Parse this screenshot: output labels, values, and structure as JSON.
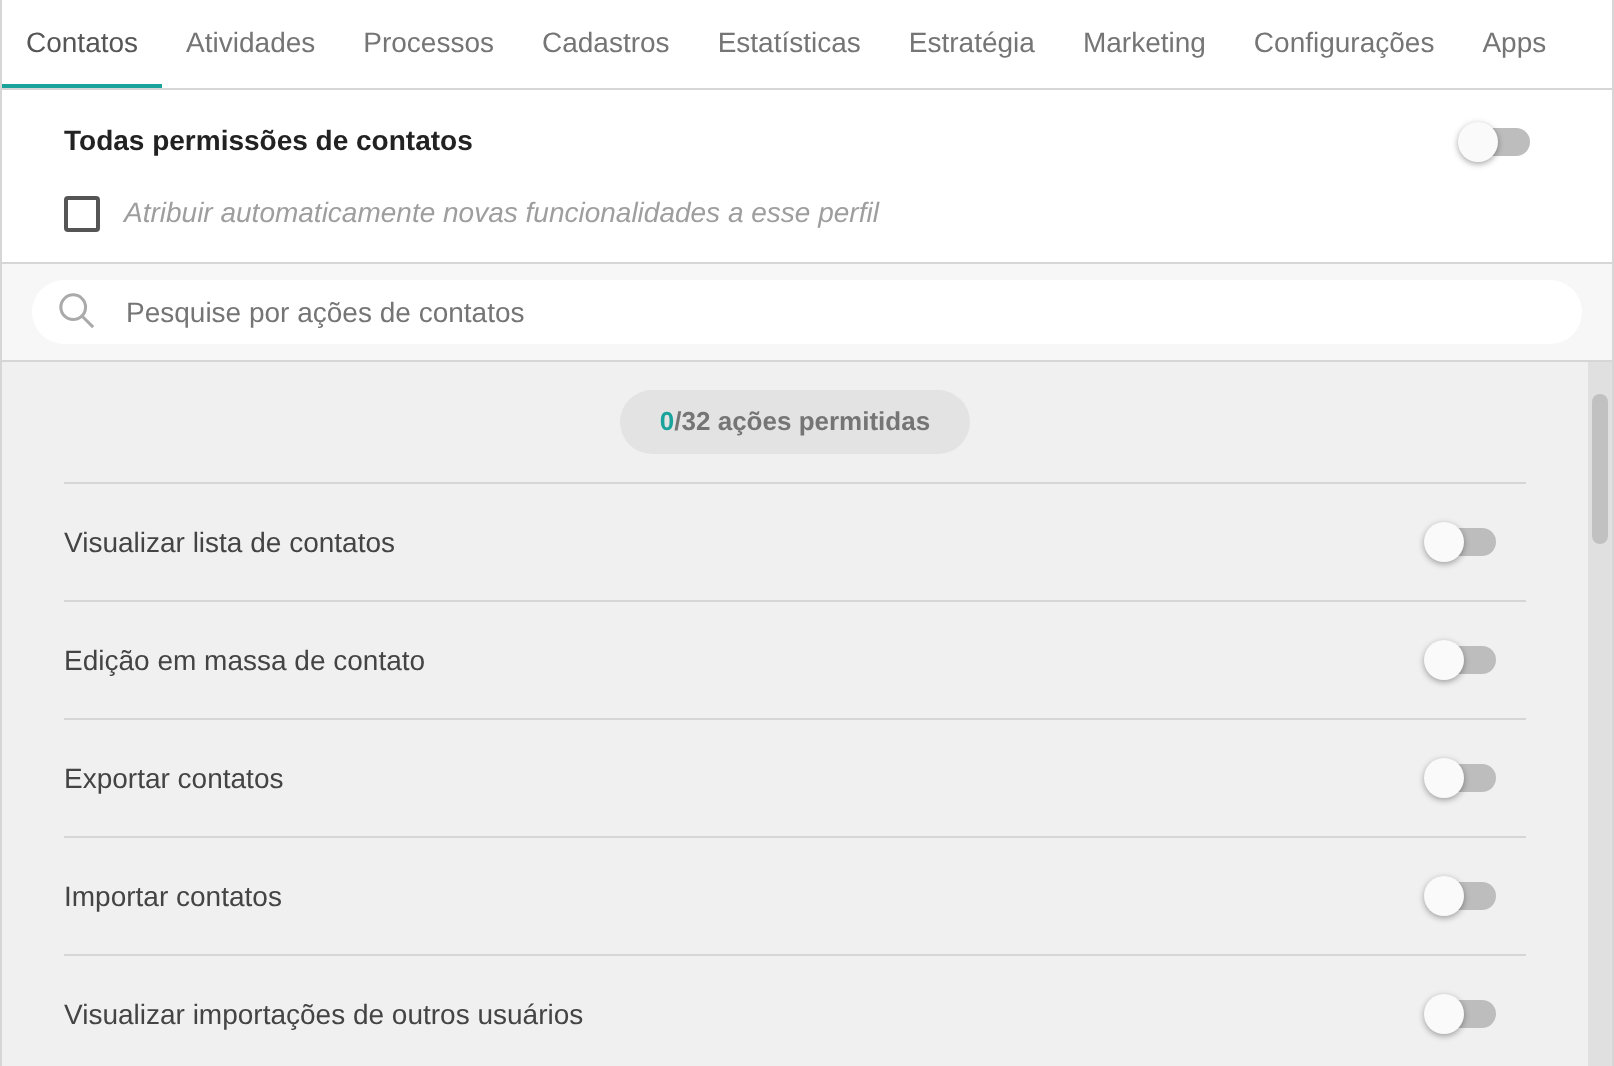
{
  "tabs": [
    {
      "label": "Contatos",
      "selected": true
    },
    {
      "label": "Atividades",
      "selected": false
    },
    {
      "label": "Processos",
      "selected": false
    },
    {
      "label": "Cadastros",
      "selected": false
    },
    {
      "label": "Estatísticas",
      "selected": false
    },
    {
      "label": "Estratégia",
      "selected": false
    },
    {
      "label": "Marketing",
      "selected": false
    },
    {
      "label": "Configurações",
      "selected": false
    },
    {
      "label": "Apps",
      "selected": false
    }
  ],
  "all_permissions": {
    "label": "Todas permissões de contatos",
    "on": false
  },
  "auto_assign": {
    "label": "Atribuir automaticamente novas funcionalidades a esse perfil",
    "checked": false
  },
  "search": {
    "placeholder": "Pesquise por ações de contatos"
  },
  "counter": {
    "allowed": "0",
    "rest": "/32 ações permitidas"
  },
  "permissions": [
    {
      "label": "Visualizar lista de contatos",
      "on": false
    },
    {
      "label": "Edição em massa de contato",
      "on": false
    },
    {
      "label": "Exportar contatos",
      "on": false
    },
    {
      "label": "Importar contatos",
      "on": false
    },
    {
      "label": "Visualizar importações de outros usuários",
      "on": false
    }
  ]
}
